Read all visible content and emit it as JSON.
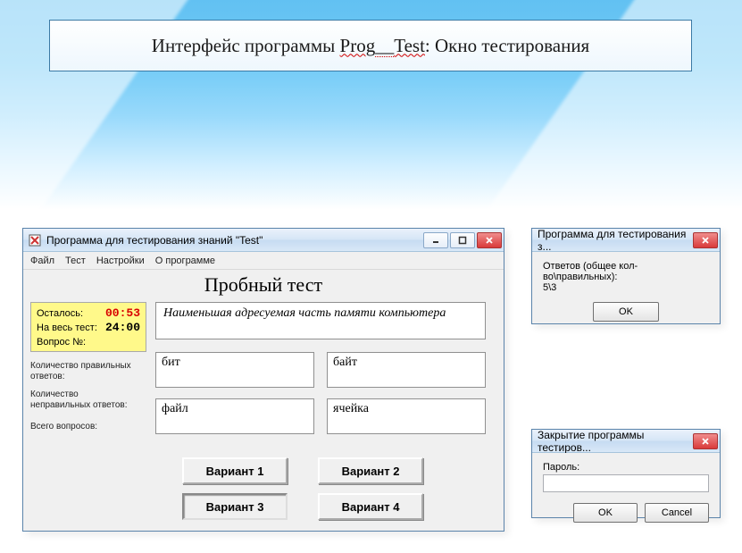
{
  "slide": {
    "title_pre": "Интерфейс программы ",
    "title_prog": "Prog",
    "title_sep": "__",
    "title_test": "Test",
    "title_post": ": Окно тестирования"
  },
  "main_window": {
    "title": "Программа для тестирования знаний \"Test\"",
    "menu": {
      "file": "Файл",
      "test": "Тест",
      "settings": "Настройки",
      "about": "О программе"
    },
    "heading": "Пробный тест",
    "timer": {
      "remaining_label": "Осталось:",
      "remaining_value": "00:53",
      "total_label": "На весь тест:",
      "total_value": "24:00",
      "question_label": "Вопрос №:",
      "question_value": ""
    },
    "stats": {
      "correct_label": "Количество правильных ответов:",
      "correct_value": "",
      "wrong_label": "Количество неправильных ответов:",
      "wrong_value": "",
      "total_label": "Всего вопросов:",
      "total_value": ""
    },
    "question": "Наименьшая адресуемая часть памяти компьютера",
    "answers": {
      "a1": "бит",
      "a2": "байт",
      "a3": "файл",
      "a4": "ячейка"
    },
    "variants": {
      "v1": "Вариант 1",
      "v2": "Вариант 2",
      "v3": "Вариант 3",
      "v4": "Вариант 4"
    }
  },
  "results_dialog": {
    "title": "Программа для тестирования з...",
    "line1": "Ответов (общее кол-во\\правильных):",
    "line2": "5\\3",
    "ok": "OK"
  },
  "close_dialog": {
    "title": "Закрытие программы тестиров...",
    "password_label": "Пароль:",
    "password_value": "",
    "ok": "OK",
    "cancel": "Cancel"
  }
}
